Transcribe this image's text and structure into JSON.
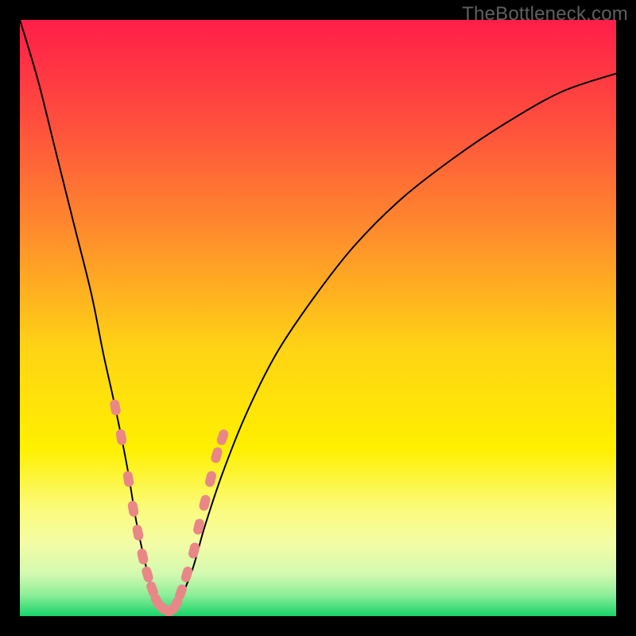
{
  "watermark": "TheBottleneck.com",
  "chart_data": {
    "type": "line",
    "title": "",
    "xlabel": "",
    "ylabel": "",
    "xlim": [
      0,
      100
    ],
    "ylim": [
      0,
      100
    ],
    "background_gradient": {
      "stops": [
        {
          "offset": 0.0,
          "color": "#ff1e49"
        },
        {
          "offset": 0.16,
          "color": "#ff4b3e"
        },
        {
          "offset": 0.35,
          "color": "#ff8a2d"
        },
        {
          "offset": 0.55,
          "color": "#ffd315"
        },
        {
          "offset": 0.72,
          "color": "#fff000"
        },
        {
          "offset": 0.82,
          "color": "#fbfb7c"
        },
        {
          "offset": 0.88,
          "color": "#f3fca6"
        },
        {
          "offset": 0.93,
          "color": "#d2f9b0"
        },
        {
          "offset": 0.965,
          "color": "#8bee98"
        },
        {
          "offset": 1.0,
          "color": "#18d46a"
        }
      ]
    },
    "series": [
      {
        "name": "bottleneck-curve",
        "color": "#000000",
        "stroke_width": 2,
        "x": [
          0,
          3,
          6,
          9,
          12,
          14,
          16,
          18,
          19.5,
          21,
          22,
          23,
          24,
          25,
          26,
          27,
          29,
          31,
          34,
          38,
          43,
          49,
          56,
          64,
          73,
          82,
          91,
          100
        ],
        "values": [
          100,
          90,
          78,
          66,
          54,
          44,
          35,
          25,
          16,
          9,
          5,
          2,
          1,
          0.5,
          1,
          3,
          8,
          15,
          24,
          34,
          44,
          53,
          62,
          70,
          77,
          83,
          88,
          91
        ]
      }
    ],
    "markers": {
      "name": "highlight-points",
      "color": "#e98787",
      "radius": 6,
      "points": [
        {
          "x": 16.0,
          "y": 35.0
        },
        {
          "x": 17.0,
          "y": 30.0
        },
        {
          "x": 18.2,
          "y": 23.0
        },
        {
          "x": 19.0,
          "y": 18.0
        },
        {
          "x": 19.8,
          "y": 14.0
        },
        {
          "x": 20.6,
          "y": 10.0
        },
        {
          "x": 21.4,
          "y": 7.0
        },
        {
          "x": 22.2,
          "y": 4.5
        },
        {
          "x": 23.0,
          "y": 2.5
        },
        {
          "x": 23.8,
          "y": 1.5
        },
        {
          "x": 24.6,
          "y": 1.0
        },
        {
          "x": 25.4,
          "y": 1.0
        },
        {
          "x": 26.2,
          "y": 2.0
        },
        {
          "x": 27.0,
          "y": 4.0
        },
        {
          "x": 28.0,
          "y": 7.0
        },
        {
          "x": 29.2,
          "y": 11.0
        },
        {
          "x": 30.0,
          "y": 15.0
        },
        {
          "x": 31.0,
          "y": 19.0
        },
        {
          "x": 32.0,
          "y": 23.0
        },
        {
          "x": 33.0,
          "y": 27.0
        },
        {
          "x": 34.0,
          "y": 30.0
        }
      ]
    }
  }
}
